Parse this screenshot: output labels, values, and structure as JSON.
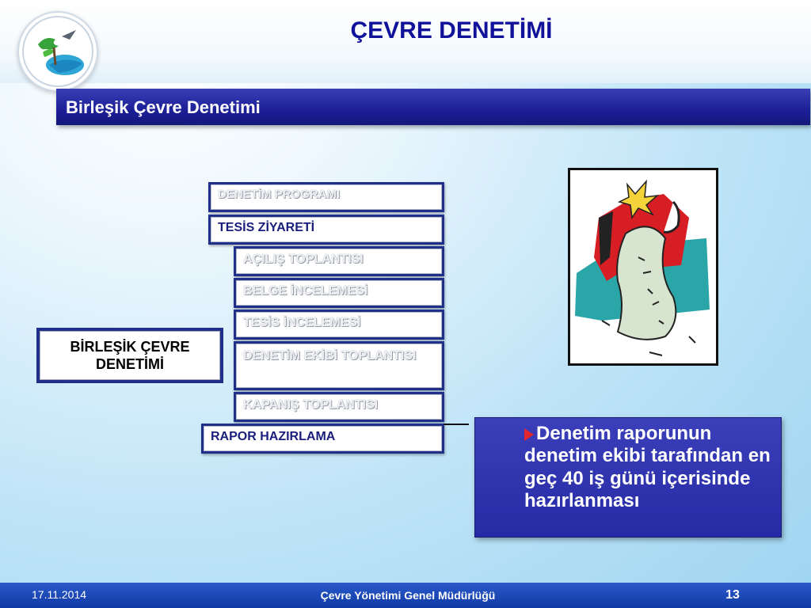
{
  "header": {
    "title": "ÇEVRE DENETİMİ",
    "logo_icon": "ministry-logo-icon"
  },
  "subtitle": "Birleşik Çevre Denetimi",
  "steps": [
    {
      "label": "DENETİM PROGRAMI",
      "state": "faded"
    },
    {
      "label": "TESİS ZİYARETİ",
      "state": "active"
    },
    {
      "label": "AÇILIŞ TOPLANTISI",
      "state": "faded"
    },
    {
      "label": "BELGE İNCELEMESİ",
      "state": "faded"
    },
    {
      "label": "TESİS İNCELEMESİ",
      "state": "faded"
    },
    {
      "label": "DENETİM EKİBİ TOPLANTISI",
      "state": "faded"
    },
    {
      "label": "KAPANIŞ TOPLANTISI",
      "state": "faded"
    },
    {
      "label": "RAPOR HAZIRLAMA",
      "state": "active"
    }
  ],
  "main_box": {
    "line1": "BİRLEŞİK ÇEVRE",
    "line2": "DENETİMİ"
  },
  "info": {
    "bullet_icon": "red-arrow-bullet-icon",
    "text": "Denetim  raporunun denetim ekibi tarafından en geç 40 iş günü içerisinde hazırlanması"
  },
  "clipart_icon": "document-clipart-icon",
  "footer": {
    "date": "17.11.2014",
    "org": "Çevre Yönetimi Genel Müdürlüğü",
    "page": "13"
  },
  "colors": {
    "title": "#10139a",
    "bar": "#1c1f96",
    "footer": "#0f3aa6",
    "active_text": "#1a1f7c"
  }
}
